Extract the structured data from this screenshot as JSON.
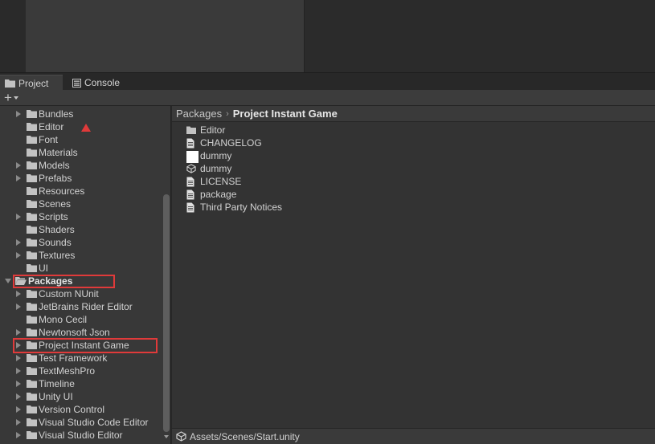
{
  "tabs": [
    {
      "label": "Project",
      "icon": "folder-icon",
      "active": true
    },
    {
      "label": "Console",
      "icon": "console-icon",
      "active": false
    }
  ],
  "toolbar": {
    "add_label": "+"
  },
  "tree": [
    {
      "label": "Bundles",
      "expandable": true
    },
    {
      "label": "Editor",
      "expandable": false
    },
    {
      "label": "Font",
      "expandable": false
    },
    {
      "label": "Materials",
      "expandable": false
    },
    {
      "label": "Models",
      "expandable": true
    },
    {
      "label": "Prefabs",
      "expandable": true
    },
    {
      "label": "Resources",
      "expandable": false
    },
    {
      "label": "Scenes",
      "expandable": false
    },
    {
      "label": "Scripts",
      "expandable": true
    },
    {
      "label": "Shaders",
      "expandable": false
    },
    {
      "label": "Sounds",
      "expandable": true
    },
    {
      "label": "Textures",
      "expandable": true
    },
    {
      "label": "UI",
      "expandable": false
    },
    {
      "label": "Packages",
      "expandable": true,
      "expanded": true,
      "root": true
    },
    {
      "label": "Custom NUnit",
      "expandable": true
    },
    {
      "label": "JetBrains Rider Editor",
      "expandable": true
    },
    {
      "label": "Mono Cecil",
      "expandable": false
    },
    {
      "label": "Newtonsoft Json",
      "expandable": true
    },
    {
      "label": "Project Instant Game",
      "expandable": true,
      "selected": true
    },
    {
      "label": "Test Framework",
      "expandable": true
    },
    {
      "label": "TextMeshPro",
      "expandable": true
    },
    {
      "label": "Timeline",
      "expandable": true
    },
    {
      "label": "Unity UI",
      "expandable": true
    },
    {
      "label": "Version Control",
      "expandable": true
    },
    {
      "label": "Visual Studio Code Editor",
      "expandable": true
    },
    {
      "label": "Visual Studio Editor",
      "expandable": true
    }
  ],
  "breadcrumb": {
    "parent": "Packages",
    "separator": "›",
    "current": "Project Instant Game"
  },
  "files": [
    {
      "label": "Editor",
      "icon": "folder-icon"
    },
    {
      "label": "CHANGELOG",
      "icon": "document-icon"
    },
    {
      "label": "dummy",
      "icon": "blank-asset-icon"
    },
    {
      "label": "dummy",
      "icon": "unity-scene-icon"
    },
    {
      "label": "LICENSE",
      "icon": "document-icon"
    },
    {
      "label": "package",
      "icon": "document-icon"
    },
    {
      "label": "Third Party Notices",
      "icon": "document-icon"
    }
  ],
  "status": {
    "path": "Assets/Scenes/Start.unity",
    "icon": "unity-scene-icon"
  },
  "colors": {
    "highlight": "#e03a3a",
    "folder": "#c2c2c2",
    "background": "#383838"
  }
}
